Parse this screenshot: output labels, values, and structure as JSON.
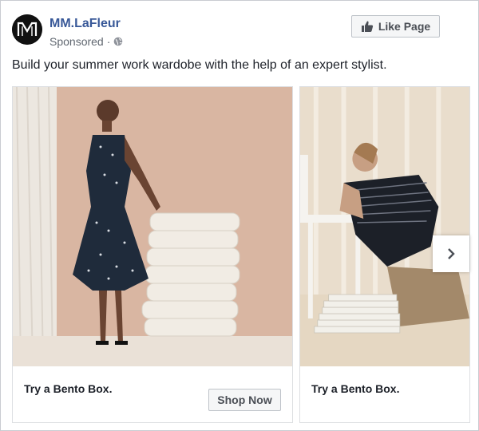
{
  "page": {
    "name": "MM.LaFleur",
    "sponsored_label": "Sponsored",
    "separator": "·",
    "logo_text": "MM"
  },
  "like_button": {
    "label": "Like Page",
    "icon": "thumbs-up-icon"
  },
  "post": {
    "text": "Build your summer work wardobe with the help of an expert stylist."
  },
  "cards": [
    {
      "caption": "Try a Bento Box.",
      "cta": "Shop Now"
    },
    {
      "caption": "Try a Bento Box."
    }
  ],
  "icons": {
    "globe": "globe-icon",
    "next": "chevron-right-icon"
  },
  "colors": {
    "link": "#385898",
    "text": "#1d2129",
    "muted": "#606770",
    "button_bg": "#f5f6f7"
  }
}
